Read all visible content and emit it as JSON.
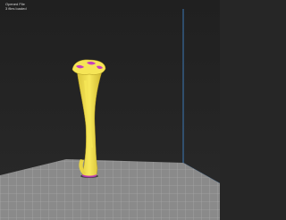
{
  "viewer": {
    "info_line_1": "Opened File",
    "info_line_2": "3 files loaded"
  },
  "scene": {
    "background_color": "#252525",
    "build_plate_color": "#8a8a8a",
    "build_volume_edge_color": "#3c78b4",
    "model_color": "#f2e04a",
    "support_highlight_color": "#c02ec8",
    "icons": [
      "build-plate",
      "build-volume",
      "bone-model"
    ]
  }
}
